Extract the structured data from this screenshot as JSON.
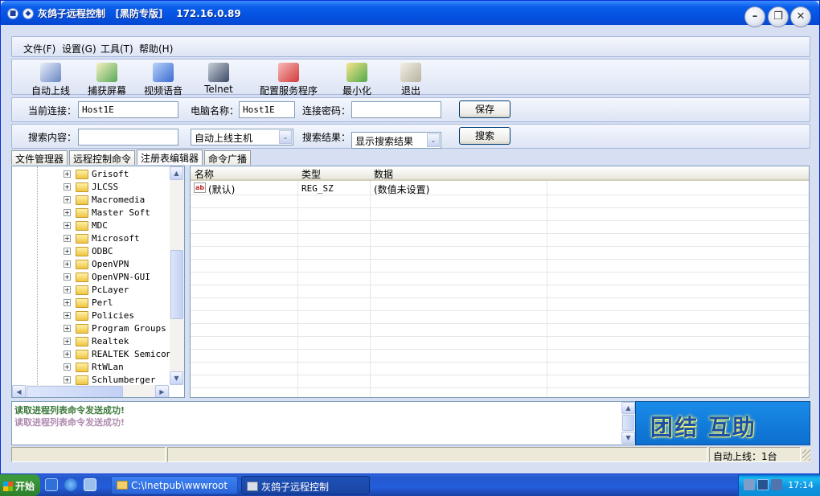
{
  "window": {
    "title": "灰鸽子远程控制   [黑防专版]    172.16.0.89"
  },
  "menu": [
    "文件(F)",
    "设置(G)",
    "工具(T)",
    "帮助(H)"
  ],
  "toolbar": [
    {
      "label": "自动上线",
      "icon": "auto-online-icon",
      "color": "#6A86C4"
    },
    {
      "label": "捕获屏幕",
      "icon": "capture-screen-icon",
      "color": "#58A858"
    },
    {
      "label": "视频语音",
      "icon": "video-voice-icon",
      "color": "#3A6BD0"
    },
    {
      "label": "Telnet",
      "icon": "telnet-icon",
      "color": "#3D4A66"
    },
    {
      "label": "配置服务程序",
      "icon": "config-service-icon",
      "color": "#D23A3A"
    },
    {
      "label": "最小化",
      "icon": "minimize-icon",
      "color": "#52A84A"
    },
    {
      "label": "退出",
      "icon": "exit-icon",
      "color": "#B8B2A0"
    }
  ],
  "connection": {
    "current_label": "当前连接：",
    "current_value": "Host1E",
    "computer_label": "电脑名称：",
    "computer_value": "Host1E",
    "password_label": "连接密码：",
    "password_value": "",
    "save_button": "保存"
  },
  "search": {
    "content_label": "搜索内容：",
    "content_value": "",
    "host_select": "自动上线主机",
    "result_label": "搜索结果：",
    "result_select": "显示搜索结果",
    "search_button": "搜索"
  },
  "tabs": [
    "文件管理器",
    "远程控制命令",
    "注册表编辑器",
    "命令广播"
  ],
  "active_tab": "注册表编辑器",
  "tree_items": [
    "Grisoft",
    "JLCSS",
    "Macromedia",
    "Master Soft",
    "MDC",
    "Microsoft",
    "ODBC",
    "OpenVPN",
    "OpenVPN-GUI",
    "PcLayer",
    "Perl",
    "Policies",
    "Program Groups",
    "Realtek",
    "REALTEK Semicond",
    "RtWLan",
    "Schlumberger"
  ],
  "list": {
    "columns": [
      "名称",
      "类型",
      "数据"
    ],
    "rows": [
      {
        "name": "(默认)",
        "type": "REG_SZ",
        "data": "(数值未设置)"
      }
    ]
  },
  "log": [
    {
      "text": "读取进程列表命令发送成功!",
      "color": "#3C7A3C"
    },
    {
      "text": "读取进程列表命令发送成功!",
      "color": "#B08CB0"
    }
  ],
  "banner": {
    "text": "团结 互助"
  },
  "status": {
    "online": "自动上线：1台"
  },
  "taskbar": {
    "start": "开始",
    "tasks": [
      {
        "label": "C:\\Inetpub\\wwwroot",
        "active": false
      },
      {
        "label": "灰鸽子远程控制",
        "active": true
      }
    ],
    "clock": "17:14"
  }
}
